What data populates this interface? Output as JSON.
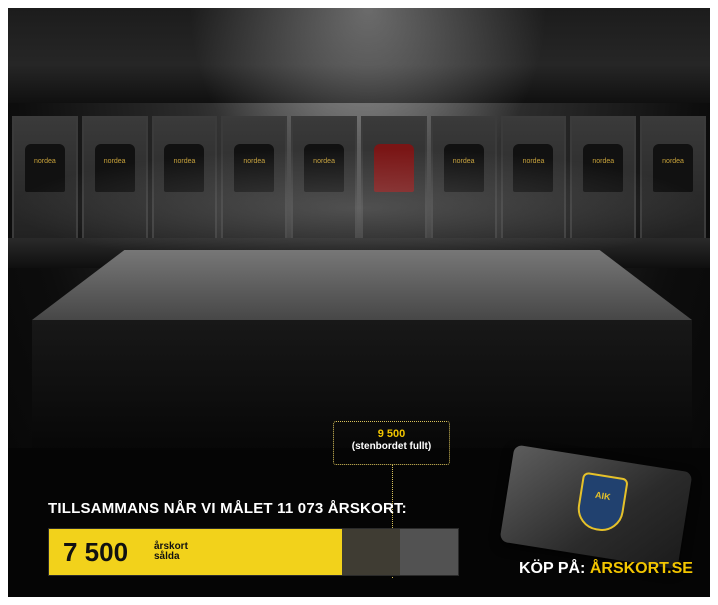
{
  "scene": {
    "lockers": [
      {
        "sponsor": "nordea",
        "highlight": false
      },
      {
        "sponsor": "nordea",
        "highlight": false
      },
      {
        "sponsor": "nordea",
        "highlight": false
      },
      {
        "sponsor": "nordea",
        "highlight": false
      },
      {
        "sponsor": "nordea",
        "highlight": false
      },
      {
        "sponsor": "",
        "highlight": true
      },
      {
        "sponsor": "nordea",
        "highlight": false
      },
      {
        "sponsor": "nordea",
        "highlight": false
      },
      {
        "sponsor": "nordea",
        "highlight": false
      },
      {
        "sponsor": "nordea",
        "highlight": false
      }
    ]
  },
  "target": {
    "value": "9 500",
    "label": "(stenbordet fullt)"
  },
  "goal": {
    "text": "TILLSAMMANS NÅR VI MÅLET 11 073 ÅRSKORT:"
  },
  "progress": {
    "sold_value": "7 500",
    "unit_line1": "årskort",
    "unit_line2": "sålda",
    "sold_fraction": 0.716,
    "target_fraction": 0.858,
    "colors": {
      "fill": "#f2d21b",
      "track": "#3f3c33",
      "target": "#525252"
    }
  },
  "card": {
    "crest_text": "AIK"
  },
  "cta": {
    "prefix": "KÖP PÅ: ",
    "link": "ÅRSKORT.SE"
  }
}
